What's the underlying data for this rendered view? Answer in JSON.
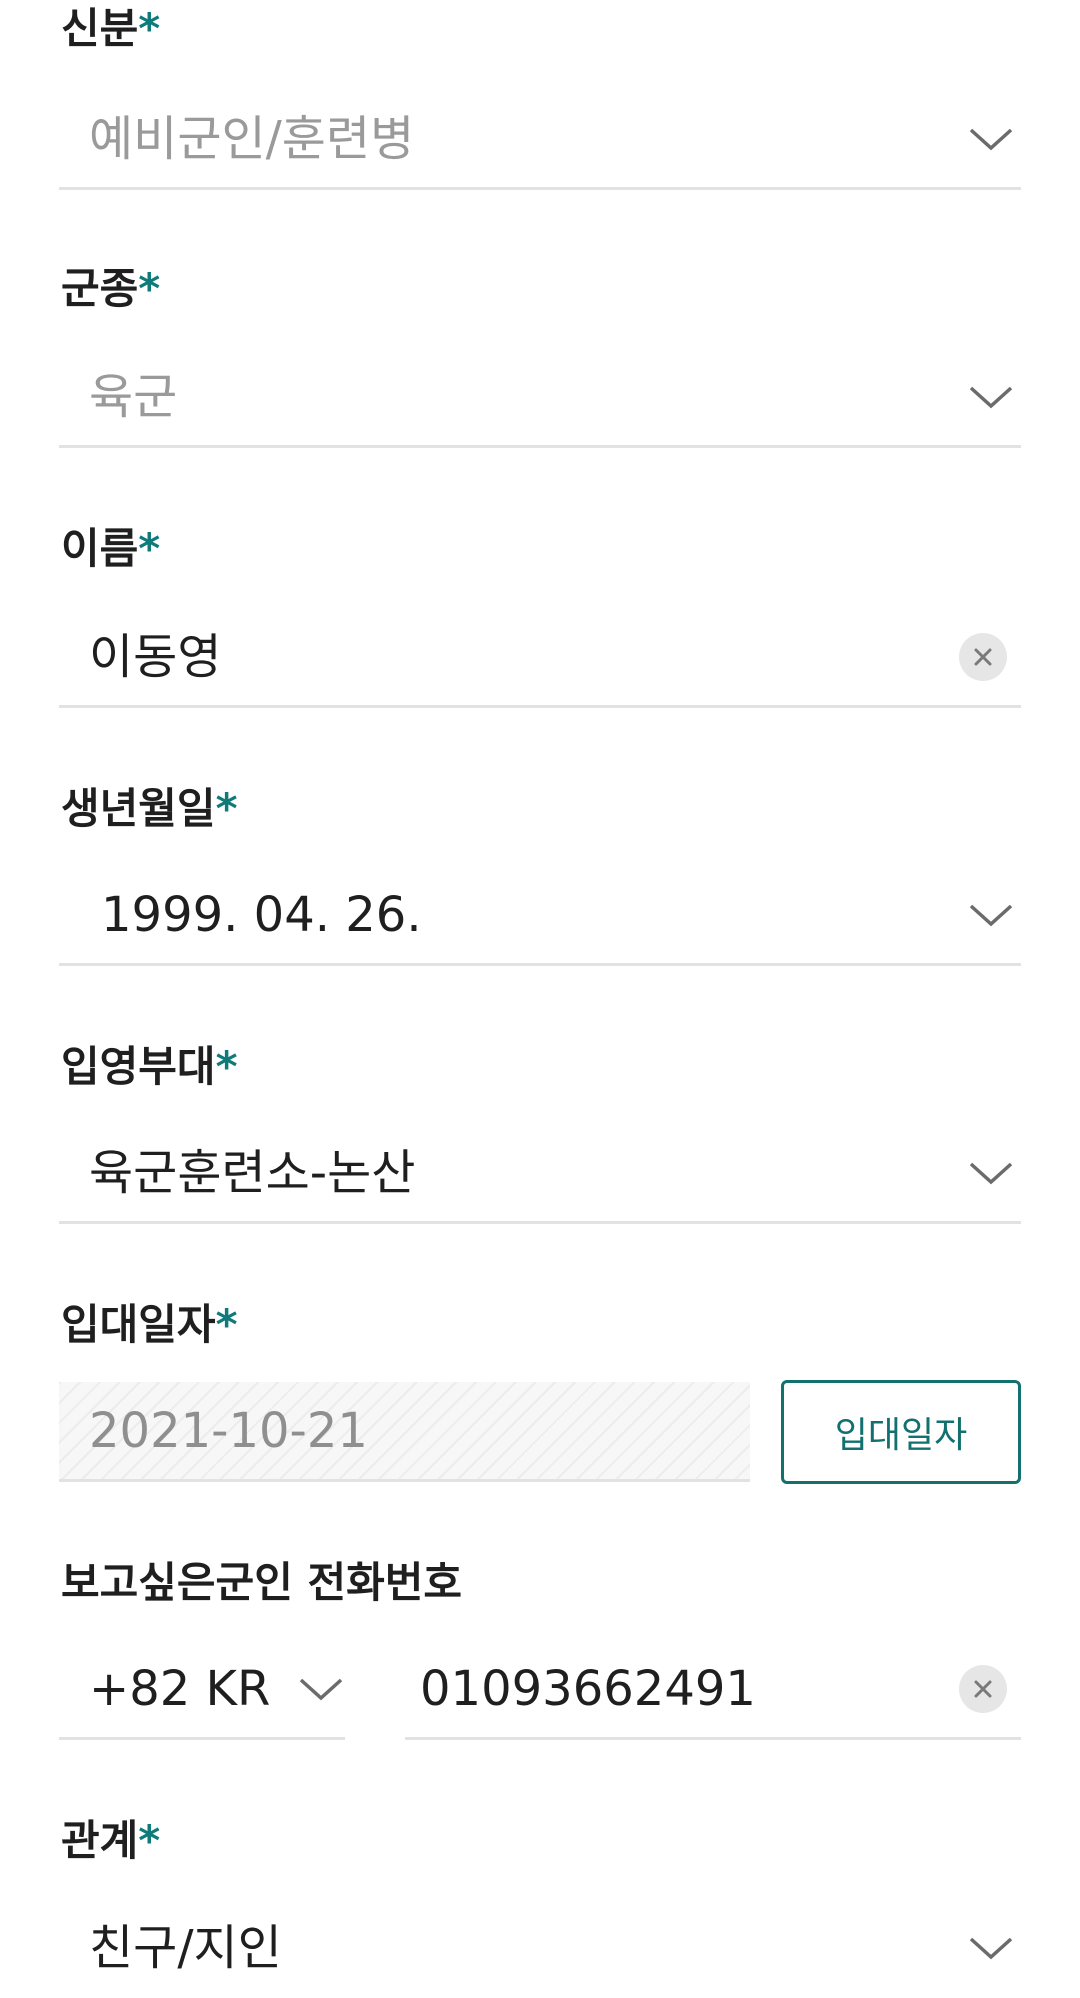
{
  "required_mark": "*",
  "colors": {
    "accent": "#12706f",
    "required": "#0e7a7a",
    "placeholder_text": "#9a9a9a",
    "divider": "#e2e2e2",
    "clear_button_bg": "#e6e6e6"
  },
  "status": {
    "label": "신분",
    "value": "예비군인/훈련병",
    "icon": "chevron-down-icon"
  },
  "branch": {
    "label": "군종",
    "value": "육군",
    "icon": "chevron-down-icon"
  },
  "name": {
    "label": "이름",
    "value": "이동영",
    "icon": "clear-icon"
  },
  "birthdate": {
    "label": "생년월일",
    "value": "1999. 04. 26.",
    "icon": "chevron-down-icon"
  },
  "unit": {
    "label": "입영부대",
    "value": "육군훈련소-논산",
    "icon": "chevron-down-icon"
  },
  "enlist_date": {
    "label": "입대일자",
    "value": "2021-10-21",
    "button_label": "입대일자"
  },
  "phone": {
    "label": "보고싶은군인 전화번호",
    "country_code": "+82 KR",
    "number": "01093662491",
    "icon": "clear-icon"
  },
  "relation": {
    "label": "관계",
    "value": "친구/지인",
    "icon": "chevron-down-icon"
  }
}
